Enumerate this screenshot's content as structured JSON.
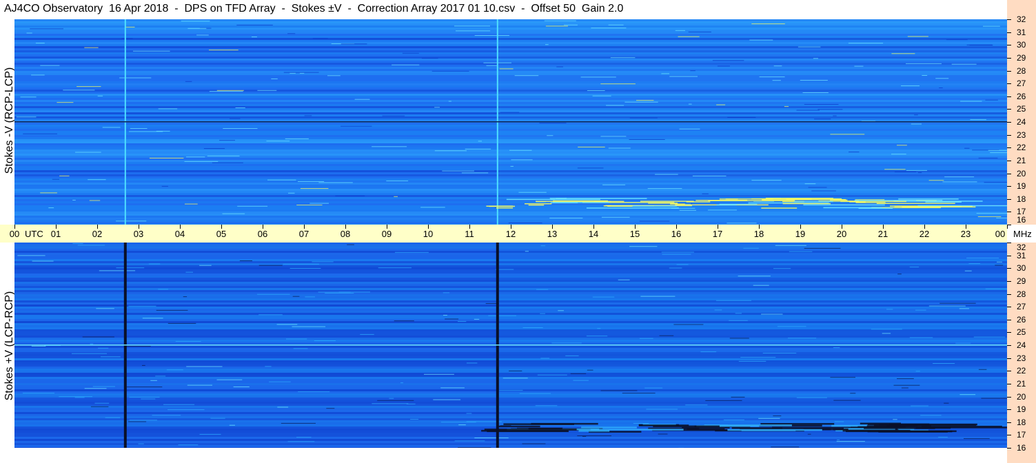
{
  "title": "AJ4CO Observatory  16 Apr 2018  -  DPS on TFD Array  -  Stokes ±V  -  Correction Array 2017 01 10.csv  -  Offset 50  Gain 2.0",
  "chart_data": [
    {
      "type": "heatmap",
      "name": "upper-panel",
      "ylabel": "Stokes -V (RCP-LCP)",
      "x_ticks": [
        "00",
        "01",
        "02",
        "03",
        "04",
        "05",
        "06",
        "07",
        "08",
        "09",
        "10",
        "11",
        "12",
        "13",
        "14",
        "15",
        "16",
        "17",
        "18",
        "19",
        "20",
        "21",
        "22",
        "23",
        "00"
      ],
      "x_unit_label": "UTC",
      "xlim_hours": [
        0,
        24
      ],
      "y_ticks": [
        16,
        17,
        18,
        19,
        20,
        21,
        22,
        23,
        24,
        25,
        26,
        27,
        28,
        29,
        30,
        31,
        32
      ],
      "y_unit_label": "MHz",
      "ylim_mhz": [
        16,
        32
      ],
      "colormap": [
        "#0a36c8",
        "#1e6ef0",
        "#1a8cf5",
        "#2fb0ff",
        "#6fe8ff",
        "#ffff5a",
        "#ff3a3a"
      ],
      "background_color": "#1e6ef0",
      "features": [
        {
          "kind": "vertical-line",
          "hour": 2.68,
          "color": "#4fe0ff"
        },
        {
          "kind": "vertical-line",
          "hour": 11.68,
          "color": "#4fe0ff"
        },
        {
          "kind": "horizontal-line",
          "mhz": 24.0,
          "color": "#0a1a50"
        },
        {
          "kind": "emission-band",
          "hours": [
            11.0,
            22.2
          ],
          "mhz": [
            17.3,
            18.1
          ],
          "color": "#ffff5a"
        }
      ]
    },
    {
      "type": "heatmap",
      "name": "lower-panel",
      "ylabel": "Stokes +V (LCP-RCP)",
      "x_ticks": [
        "00",
        "01",
        "02",
        "03",
        "04",
        "05",
        "06",
        "07",
        "08",
        "09",
        "10",
        "11",
        "12",
        "13",
        "14",
        "15",
        "16",
        "17",
        "18",
        "19",
        "20",
        "21",
        "22",
        "23",
        "00"
      ],
      "xlim_hours": [
        0,
        24
      ],
      "y_ticks": [
        16,
        17,
        18,
        19,
        20,
        21,
        22,
        23,
        24,
        25,
        26,
        27,
        28,
        29,
        30,
        31,
        32
      ],
      "ylim_mhz": [
        16,
        32
      ],
      "colormap": [
        "#0a1a50",
        "#0a36c8",
        "#1e6ef0",
        "#1a8cf5",
        "#2fb0ff",
        "#6fe8ff",
        "#ffff5a"
      ],
      "background_color": "#1a62e6",
      "features": [
        {
          "kind": "vertical-line",
          "hour": 2.68,
          "color": "#0a1028"
        },
        {
          "kind": "vertical-line",
          "hour": 11.68,
          "color": "#0a1028"
        },
        {
          "kind": "horizontal-line",
          "mhz": 24.0,
          "color": "#6fe8ff"
        },
        {
          "kind": "emission-band",
          "hours": [
            11.0,
            22.2
          ],
          "mhz": [
            17.3,
            18.0
          ],
          "color": "#0a1028"
        }
      ]
    }
  ]
}
